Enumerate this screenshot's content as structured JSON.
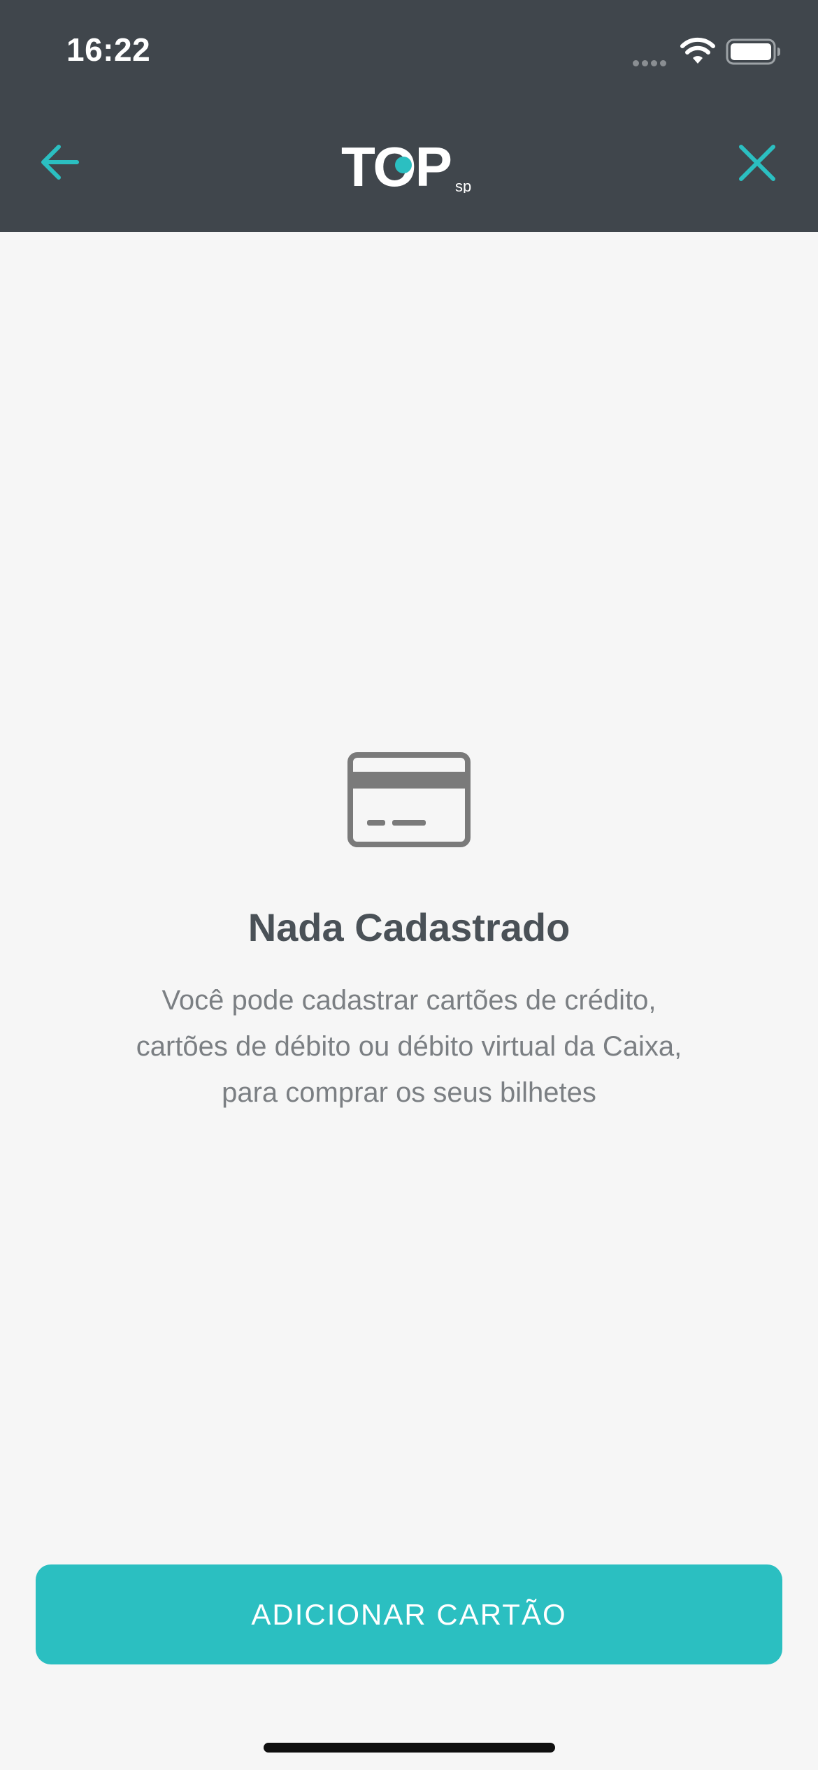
{
  "status_bar": {
    "time": "16:22"
  },
  "header": {
    "logo_text": "TOP",
    "logo_sub": "sp",
    "accent_color": "#2bbfc1",
    "background_color": "#40464c",
    "back_icon": "arrow-left-icon",
    "close_icon": "close-icon"
  },
  "empty_state": {
    "icon": "credit-card-icon",
    "title": "Nada Cadastrado",
    "description_lines": [
      "Você pode cadastrar cartões de crédito,",
      "cartões de débito ou débito virtual da Caixa,",
      "para comprar os seus bilhetes"
    ]
  },
  "actions": {
    "add_card_label": "ADICIONAR CARTÃO"
  }
}
